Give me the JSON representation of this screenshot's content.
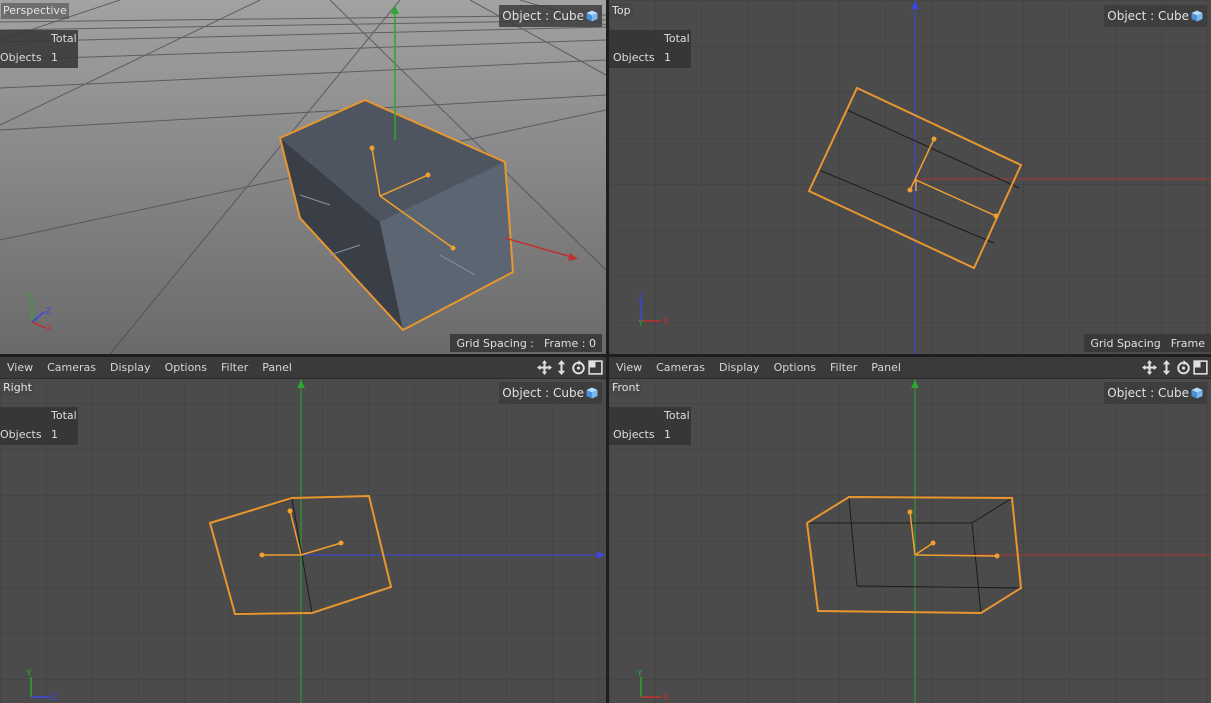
{
  "app": {
    "accent_selection": "#f0a030",
    "axis_x_color": "#c83232",
    "axis_y_color": "#32b432",
    "axis_z_color": "#3c46dc"
  },
  "menubar": [
    {
      "label": "View"
    },
    {
      "label": "Cameras"
    },
    {
      "label": "Display"
    },
    {
      "label": "Options"
    },
    {
      "label": "Filter"
    },
    {
      "label": "Panel"
    }
  ],
  "nav_icons": [
    "move-view-icon",
    "zoom-view-icon",
    "rotate-view-icon",
    "toggle-layout-icon"
  ],
  "viewports": {
    "perspective": {
      "name": "Perspective",
      "stats": {
        "header": "Total",
        "label": "Objects",
        "value": "1"
      },
      "object": {
        "label": "Object : Cube"
      },
      "hud": {
        "grid_spacing": "Grid Spacing :",
        "frame": "Frame : 0"
      },
      "axis_labels": {
        "x": "X",
        "y": "Y",
        "z": "Z"
      }
    },
    "top": {
      "name": "Top",
      "stats": {
        "header": "Total",
        "label": "Objects",
        "value": "1"
      },
      "object": {
        "label": "Object : Cube"
      },
      "hud": {
        "grid_spacing": "Grid Spacing",
        "frame": "Frame"
      },
      "axis_labels": {
        "x": "X",
        "y": "Y",
        "z": "Z"
      }
    },
    "right": {
      "name": "Right",
      "stats": {
        "header": "Total",
        "label": "Objects",
        "value": "1"
      },
      "object": {
        "label": "Object : Cube"
      },
      "axis_labels": {
        "y": "Y",
        "z": "Z"
      }
    },
    "front": {
      "name": "Front",
      "stats": {
        "header": "Total",
        "label": "Objects",
        "value": "1"
      },
      "object": {
        "label": "Object : Cube"
      },
      "axis_labels": {
        "x": "X",
        "y": "Y"
      }
    }
  }
}
